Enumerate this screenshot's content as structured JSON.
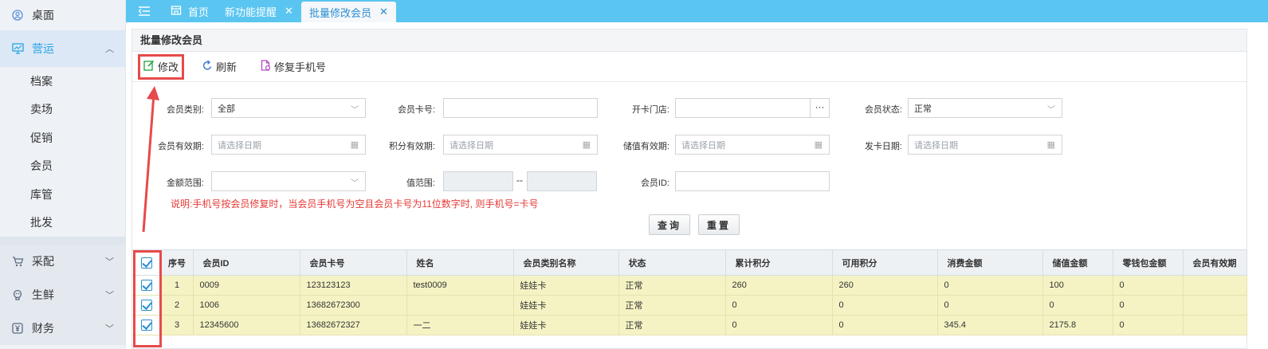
{
  "sidebar": {
    "top_item": "桌面",
    "groups": [
      {
        "label": "营运",
        "active": true,
        "icon": "chart-icon"
      },
      {
        "label": "采配",
        "icon": "cart-icon"
      },
      {
        "label": "生鲜",
        "icon": "fresh-icon"
      },
      {
        "label": "财务",
        "icon": "yen-icon"
      }
    ],
    "sub_items": [
      "档案",
      "卖场",
      "促销",
      "会员",
      "库管",
      "批发"
    ]
  },
  "tabs": [
    {
      "label": "首页",
      "icon": "home-icon"
    },
    {
      "label": "新功能提醒",
      "closable": true
    },
    {
      "label": "批量修改会员",
      "closable": true,
      "active": true
    }
  ],
  "panel": {
    "title": "批量修改会员"
  },
  "toolbar": {
    "edit": "修改",
    "refresh": "刷新",
    "fix_phone": "修复手机号"
  },
  "form": {
    "member_type": {
      "label": "会员类别:",
      "value": "全部"
    },
    "card_no": {
      "label": "会员卡号:",
      "value": ""
    },
    "store": {
      "label": "开卡门店:",
      "value": "",
      "button": "···"
    },
    "status": {
      "label": "会员状态:",
      "value": "正常"
    },
    "member_valid": {
      "label": "会员有效期:",
      "placeholder": "请选择日期"
    },
    "points_valid": {
      "label": "积分有效期:",
      "placeholder": "请选择日期"
    },
    "stored_valid": {
      "label": "储值有效期:",
      "placeholder": "请选择日期"
    },
    "issue_date": {
      "label": "发卡日期:",
      "placeholder": "请选择日期"
    },
    "amount_range": {
      "label": "金额范围:",
      "value": ""
    },
    "value_range": {
      "label": "值范围:",
      "sep": "--"
    },
    "member_id": {
      "label": "会员ID:",
      "value": ""
    },
    "note": "说明:手机号按会员修复时，当会员手机号为空且会员卡号为11位数字时, 则手机号=卡号",
    "query_btn": "查询",
    "reset_btn": "重置"
  },
  "table": {
    "headers": [
      "序号",
      "会员ID",
      "会员卡号",
      "姓名",
      "会员类别名称",
      "状态",
      "累计积分",
      "可用积分",
      "消费金额",
      "储值金额",
      "零钱包金额",
      "会员有效期"
    ],
    "rows": [
      [
        "1",
        "0009",
        "123123123",
        "test0009",
        "娃娃卡",
        "正常",
        "260",
        "260",
        "0",
        "100",
        "0",
        ""
      ],
      [
        "2",
        "1006",
        "13682672300",
        "",
        "娃娃卡",
        "正常",
        "0",
        "0",
        "0",
        "0",
        "0",
        ""
      ],
      [
        "3",
        "12345600",
        "13682672327",
        "一二",
        "娃娃卡",
        "正常",
        "0",
        "0",
        "345.4",
        "2175.8",
        "0",
        ""
      ]
    ]
  },
  "colors": {
    "accent": "#5ac5f0",
    "highlight": "#e74a4a",
    "row_bg": "#f5f3c4"
  }
}
